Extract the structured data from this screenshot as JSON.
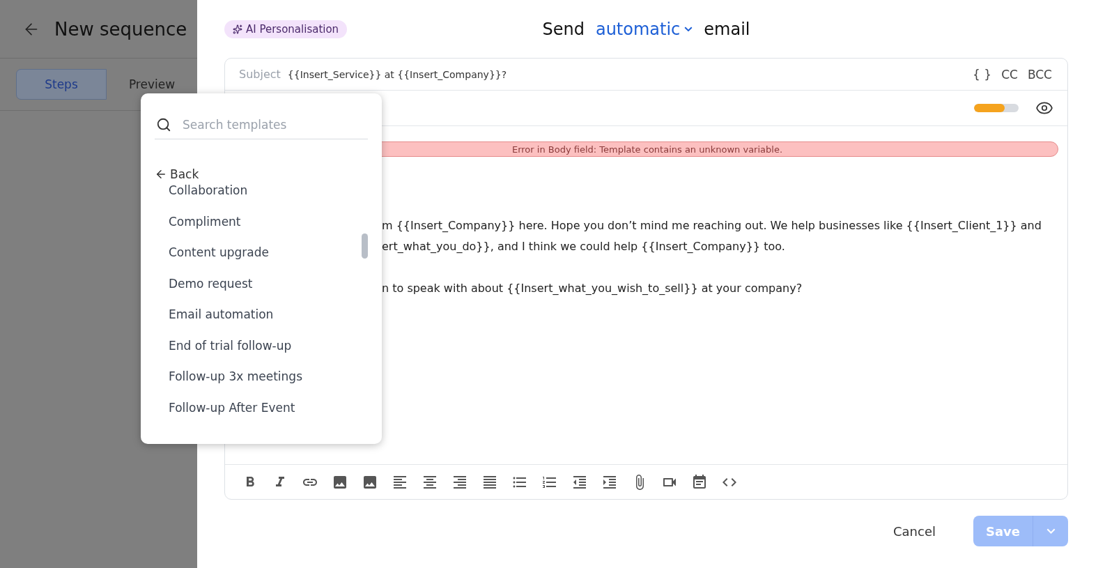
{
  "sidebar": {
    "title": "New sequence",
    "tabs": [
      {
        "label": "Steps",
        "selected": true
      },
      {
        "label": "Preview",
        "selected": false
      }
    ]
  },
  "header": {
    "badge": "AI Personalisation",
    "title_before": "Send",
    "mode": "automatic",
    "title_after": "email"
  },
  "editor": {
    "subject_label": "Subject",
    "subject_value": "{{Insert_Service}} at {{Insert_Company}}?",
    "variables": "{ }",
    "cc": "CC",
    "bcc": "BCC",
    "score": {
      "level": 0.68
    },
    "error": "Error in Body field: Template contains an unknown variable.",
    "body_paragraphs": [
      [
        "m {{Insert_Company}} here. Hope you don’t mind me reaching out. We help businesses like {{Insert_Client_1}} and",
        "ert_what_you_do}}, and I think we could help {{Insert_Company}} too."
      ],
      [
        "n to speak with about {{Insert_what_you_wish_to_sell}} at your company?"
      ]
    ]
  },
  "template_menu": {
    "placeholder": "Search templates",
    "back": "Back",
    "items": [
      "Collaboration",
      "Compliment",
      "Content upgrade",
      "Demo request",
      "Email automation",
      "End of trial follow-up",
      "Follow-up 3x meetings",
      "Follow-up After Event"
    ]
  },
  "footer": {
    "cancel": "Cancel",
    "save": "Save",
    "save_disabled": true
  }
}
